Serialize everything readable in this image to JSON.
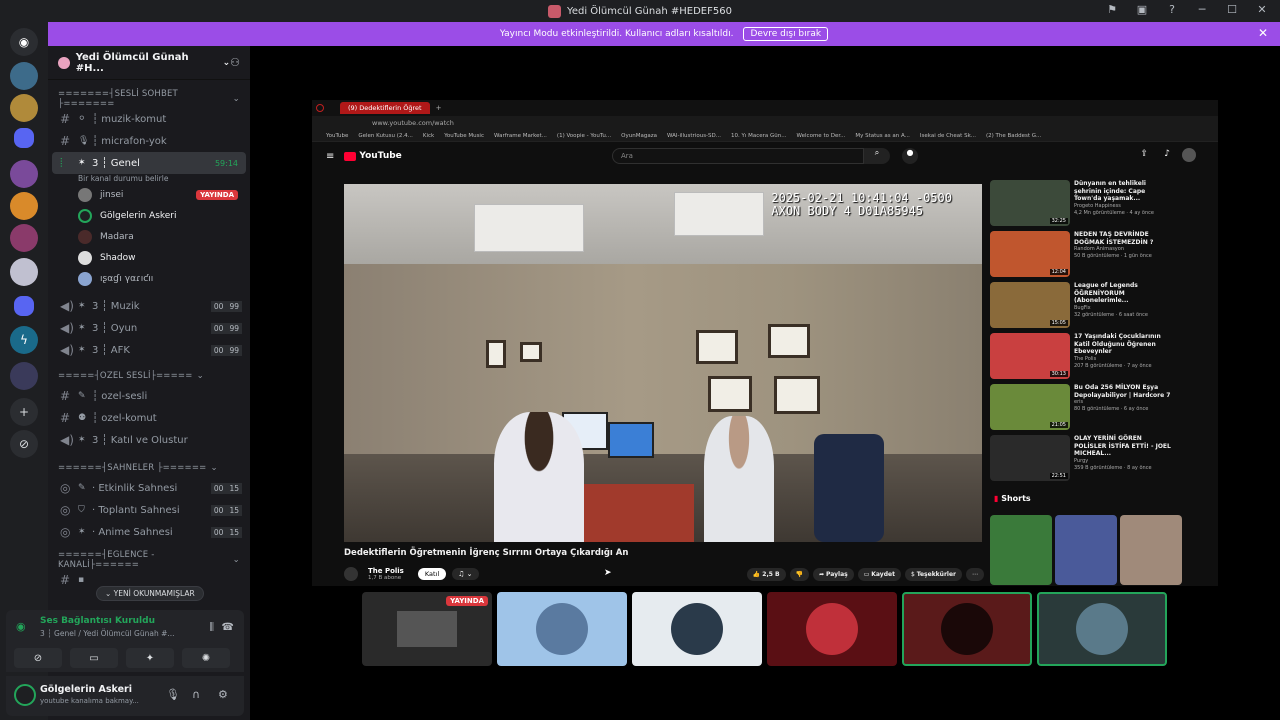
{
  "window": {
    "title": "Yedi Ölümcül Günah #HEDEF560"
  },
  "banner": {
    "text": "Yayıncı Modu etkinleştirildi. Kullanıcı adları kısaltıldı.",
    "button": "Devre dışı bırak"
  },
  "server": {
    "name": "Yedi Ölümcül Günah #H..."
  },
  "sidebar": {
    "cat_voice": "=======┤SESLİ SOHBET ├=======",
    "ch_muzik_komut": "┆ muzik-komut",
    "ch_micfrafon_yok": "┆ micrafon-yok",
    "active_channel": "3 ┆ Genel",
    "active_time": "59:14",
    "active_status": "Bir kanal durumu belirle",
    "users": [
      {
        "name": "jinsei",
        "badge": "YAYINDA"
      },
      {
        "name": "Gölgelerin Askeri"
      },
      {
        "name": "Madara"
      },
      {
        "name": "Shadow"
      },
      {
        "name": "ıʂαɠı γαɾıƈıı"
      }
    ],
    "ch_muzik": "3 ┆ Muzik",
    "ch_oyun": "3 ┆ Oyun",
    "ch_afk": "3 ┆ AFK",
    "count_a": "00",
    "count_b": "99",
    "cat_ozel": "=====┤OZEL SESLİ├=====",
    "ch_ozel_sesli": "┆ ozel-sesli",
    "ch_ozel_komut": "┆ ozel-komut",
    "ch_katil": "3 ┆ Katıl ve Olustur",
    "cat_sahne": "======┤SAHNELER ├======",
    "ch_etkinlik": "· Etkinlik Sahnesi",
    "ch_toplanti": "· Toplantı Sahnesi",
    "ch_anime": "· Anime Sahnesi",
    "stage_count_b": "15",
    "cat_eglence": "======┤EGLENCE - KANALİ├======",
    "unread": "YENİ OKUNMAMIŞLAR"
  },
  "voice_panel": {
    "title": "Ses Bağlantısı Kuruldu",
    "sub": "3 ┆ Genel / Yedi Ölümcül Günah #..."
  },
  "user_panel": {
    "name": "Gölgelerin Askeri",
    "status": "youtube kanalıma bakmay..."
  },
  "browser": {
    "tab": "(9) Dedektiflerin Öğret",
    "url": "www.youtube.com/watch",
    "bookmarks": [
      "YouTube",
      "Gelen Kutusu (2.4...",
      "Kick",
      "YouTube Music",
      "Warframe Market...",
      "(1) Voopie - YouTu...",
      "OyunMagaza",
      "WAI-illustrious-SD...",
      "10. Yı Macera Gün...",
      "Welcome to Der...",
      "My Status as an A...",
      "Isekai de Cheat Sk...",
      "(2) The Baddest G..."
    ]
  },
  "youtube": {
    "logo": "YouTube",
    "search_placeholder": "Ara",
    "osd_line1": "2025-02-21 10:41:04 -0500",
    "osd_line2": "AXON BODY 4 D01A85945",
    "video_title": "Dedektiflerin Öğretmenin İğrenç Sırrını Ortaya Çıkardığı An",
    "channel": "The Polis",
    "subs": "1,7 B abone",
    "join": "Katıl",
    "likes": "2,5 B",
    "share": "Paylaş",
    "save": "Kaydet",
    "thanks": "Teşekkürler",
    "shorts": "Shorts",
    "recs": [
      {
        "title": "Dünyanın en tehlikeli şehrinin içinde: Cape Town'da yaşamak...",
        "channel": "Progeto Happiness",
        "meta": "4,2 Mn görüntüleme · 4 ay önce",
        "dur": "32:25",
        "color": "#3c4a3a"
      },
      {
        "title": "NEDEN TAŞ DEVRİNDE DOĞMAK İSTEMEZDİN ?",
        "channel": "Random Animasyon",
        "meta": "50 B görüntüleme · 1 gün önce",
        "dur": "12:04",
        "color": "#c0562e"
      },
      {
        "title": "League of Legends ÖĞRENİYORUM (Abonelerimle...",
        "channel": "BugFix",
        "meta": "32 görüntüleme · 6 saat önce",
        "dur": "15:05",
        "color": "#8a6a3a"
      },
      {
        "title": "17 Yaşındaki Çocuklarının Katil Olduğunu Öğrenen Ebeveynler",
        "channel": "The Polis",
        "meta": "207 B görüntüleme · 7 ay önce",
        "dur": "30:13",
        "color": "#c94040"
      },
      {
        "title": "Bu Oda 256 MİLYON Eşya Depolayabiliyor | Hardcore 7",
        "channel": "eris",
        "meta": "80 B görüntüleme · 6 ay önce",
        "dur": "21:05",
        "color": "#6a8a3a"
      },
      {
        "title": "OLAY YERİNİ GÖREN POLİSLER İSTİFA ETTİ! - JOEL MICHEAL...",
        "channel": "Purgy",
        "meta": "359 B görüntüleme · 8 ay önce",
        "dur": "22:51",
        "color": "#2a2a2a"
      }
    ]
  },
  "tiles": {
    "live": "YAYINDA"
  }
}
